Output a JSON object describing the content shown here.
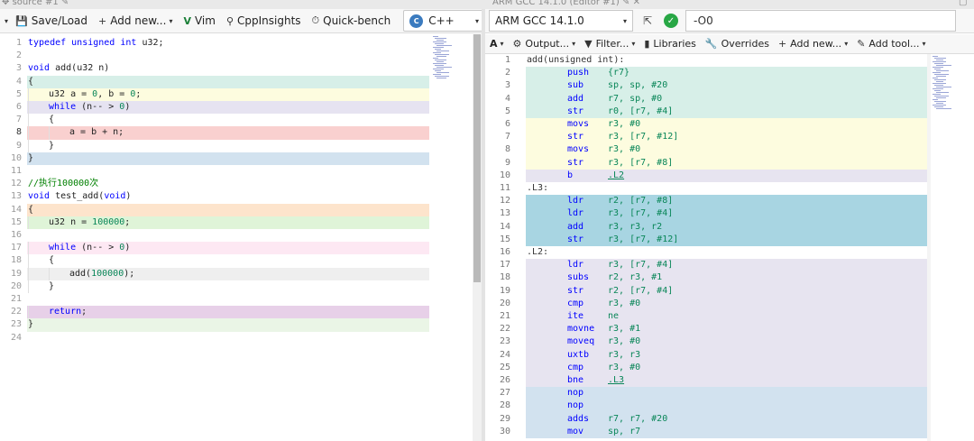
{
  "left_tab": {
    "title": "source #1"
  },
  "right_tab": {
    "title": "ARM GCC 14.1.0 (Editor #1)"
  },
  "toolbar": {
    "save_load": "Save/Load",
    "add_new": "Add new...",
    "vim": "Vim",
    "cppinsights": "CppInsights",
    "quick_bench": "Quick-bench",
    "language": "C++"
  },
  "compiler": {
    "name": "ARM GCC 14.1.0",
    "options": "-O0"
  },
  "output_toolbar": {
    "output": "Output...",
    "filter": "Filter...",
    "libraries": "Libraries",
    "overrides": "Overrides",
    "add_new": "Add new...",
    "add_tool": "Add tool..."
  },
  "colors": {
    "teal": "#d7efe8",
    "yellow": "#fdfcdf",
    "lavender": "#e6e3f1",
    "red": "#f9d0cf",
    "blue": "#d2e2ef",
    "orange": "#fde4cc",
    "green": "#dff4d8",
    "pink": "#fde8f3",
    "gray": "#efefef",
    "purple": "#e7d0e8",
    "light_green": "#eaf5e6",
    "cyan": "#a8d5e2",
    "asm_lav": "#e7e4f0"
  },
  "source_lines": [
    {
      "n": "1",
      "bg": "",
      "indent": 0,
      "tokens": [
        [
          "kw",
          "typedef unsigned int"
        ],
        [
          "",
          "u32;"
        ]
      ]
    },
    {
      "n": "2",
      "bg": "",
      "indent": 0,
      "tokens": []
    },
    {
      "n": "3",
      "bg": "",
      "indent": 0,
      "tokens": [
        [
          "kw",
          "void"
        ],
        [
          "",
          " add(u32 n)"
        ]
      ]
    },
    {
      "n": "4",
      "bg": "teal",
      "indent": 0,
      "tokens": [
        [
          "",
          "{"
        ]
      ]
    },
    {
      "n": "5",
      "bg": "yellow",
      "indent": 1,
      "tokens": [
        [
          "",
          "u32 a = "
        ],
        [
          "num",
          "0"
        ],
        [
          "",
          ", b = "
        ],
        [
          "num",
          "0"
        ],
        [
          "",
          ";"
        ]
      ]
    },
    {
      "n": "6",
      "bg": "lavender",
      "indent": 1,
      "tokens": [
        [
          "kw",
          "while"
        ],
        [
          "",
          " (n-- > "
        ],
        [
          "num",
          "0"
        ],
        [
          "",
          ")"
        ]
      ]
    },
    {
      "n": "7",
      "bg": "",
      "indent": 1,
      "tokens": [
        [
          "",
          "{"
        ]
      ]
    },
    {
      "n": "8",
      "bg": "red",
      "indent": 2,
      "tokens": [
        [
          "",
          "a = b + n;"
        ]
      ]
    },
    {
      "n": "9",
      "bg": "",
      "indent": 1,
      "tokens": [
        [
          "",
          "}"
        ]
      ]
    },
    {
      "n": "10",
      "bg": "blue",
      "indent": 0,
      "tokens": [
        [
          "",
          "}"
        ]
      ]
    },
    {
      "n": "11",
      "bg": "",
      "indent": 0,
      "tokens": []
    },
    {
      "n": "12",
      "bg": "",
      "indent": 0,
      "tokens": [
        [
          "cm",
          "//执行100000次"
        ]
      ]
    },
    {
      "n": "13",
      "bg": "",
      "indent": 0,
      "tokens": [
        [
          "kw",
          "void"
        ],
        [
          "",
          " test_add("
        ],
        [
          "kw",
          "void"
        ],
        [
          "",
          ")"
        ]
      ]
    },
    {
      "n": "14",
      "bg": "orange",
      "indent": 0,
      "tokens": [
        [
          "",
          "{"
        ]
      ]
    },
    {
      "n": "15",
      "bg": "green",
      "indent": 1,
      "tokens": [
        [
          "",
          "u32 n = "
        ],
        [
          "num",
          "100000"
        ],
        [
          "",
          ";"
        ]
      ]
    },
    {
      "n": "16",
      "bg": "",
      "indent": 0,
      "tokens": []
    },
    {
      "n": "17",
      "bg": "pink",
      "indent": 1,
      "tokens": [
        [
          "kw",
          "while"
        ],
        [
          "",
          " (n-- > "
        ],
        [
          "num",
          "0"
        ],
        [
          "",
          ")"
        ]
      ]
    },
    {
      "n": "18",
      "bg": "",
      "indent": 1,
      "tokens": [
        [
          "",
          "{"
        ]
      ]
    },
    {
      "n": "19",
      "bg": "gray",
      "indent": 2,
      "tokens": [
        [
          "",
          "add("
        ],
        [
          "num",
          "100000"
        ],
        [
          "",
          ");"
        ]
      ]
    },
    {
      "n": "20",
      "bg": "",
      "indent": 1,
      "tokens": [
        [
          "",
          "}"
        ]
      ]
    },
    {
      "n": "21",
      "bg": "",
      "indent": 0,
      "tokens": []
    },
    {
      "n": "22",
      "bg": "purple",
      "indent": 1,
      "tokens": [
        [
          "kw",
          "return"
        ],
        [
          "",
          ";"
        ]
      ]
    },
    {
      "n": "23",
      "bg": "light_green",
      "indent": 0,
      "tokens": [
        [
          "",
          "}"
        ]
      ]
    },
    {
      "n": "24",
      "bg": "",
      "indent": 0,
      "tokens": []
    }
  ],
  "asm_lines": [
    {
      "n": "1",
      "bg": "",
      "label": "add(unsigned int):",
      "mn": "",
      "ops": ""
    },
    {
      "n": "2",
      "bg": "teal",
      "label": "",
      "mn": "push",
      "ops": "{r7}"
    },
    {
      "n": "3",
      "bg": "teal",
      "label": "",
      "mn": "sub",
      "ops": "sp, sp, #20"
    },
    {
      "n": "4",
      "bg": "teal",
      "label": "",
      "mn": "add",
      "ops": "r7, sp, #0"
    },
    {
      "n": "5",
      "bg": "teal",
      "label": "",
      "mn": "str",
      "ops": "r0, [r7, #4]"
    },
    {
      "n": "6",
      "bg": "yellow",
      "label": "",
      "mn": "movs",
      "ops": "r3, #0"
    },
    {
      "n": "7",
      "bg": "yellow",
      "label": "",
      "mn": "str",
      "ops": "r3, [r7, #12]"
    },
    {
      "n": "8",
      "bg": "yellow",
      "label": "",
      "mn": "movs",
      "ops": "r3, #0"
    },
    {
      "n": "9",
      "bg": "yellow",
      "label": "",
      "mn": "str",
      "ops": "r3, [r7, #8]"
    },
    {
      "n": "10",
      "bg": "asm_lav",
      "label": "",
      "mn": "b",
      "ops": ".L2",
      "ref": true
    },
    {
      "n": "11",
      "bg": "",
      "label": ".L3:",
      "mn": "",
      "ops": ""
    },
    {
      "n": "12",
      "bg": "cyan",
      "label": "",
      "mn": "ldr",
      "ops": "r2, [r7, #8]"
    },
    {
      "n": "13",
      "bg": "cyan",
      "label": "",
      "mn": "ldr",
      "ops": "r3, [r7, #4]"
    },
    {
      "n": "14",
      "bg": "cyan",
      "label": "",
      "mn": "add",
      "ops": "r3, r3, r2"
    },
    {
      "n": "15",
      "bg": "cyan",
      "label": "",
      "mn": "str",
      "ops": "r3, [r7, #12]"
    },
    {
      "n": "16",
      "bg": "",
      "label": ".L2:",
      "mn": "",
      "ops": ""
    },
    {
      "n": "17",
      "bg": "asm_lav",
      "label": "",
      "mn": "ldr",
      "ops": "r3, [r7, #4]"
    },
    {
      "n": "18",
      "bg": "asm_lav",
      "label": "",
      "mn": "subs",
      "ops": "r2, r3, #1"
    },
    {
      "n": "19",
      "bg": "asm_lav",
      "label": "",
      "mn": "str",
      "ops": "r2, [r7, #4]"
    },
    {
      "n": "20",
      "bg": "asm_lav",
      "label": "",
      "mn": "cmp",
      "ops": "r3, #0"
    },
    {
      "n": "21",
      "bg": "asm_lav",
      "label": "",
      "mn": "ite",
      "ops": "ne"
    },
    {
      "n": "22",
      "bg": "asm_lav",
      "label": "",
      "mn": "movne",
      "ops": "r3, #1"
    },
    {
      "n": "23",
      "bg": "asm_lav",
      "label": "",
      "mn": "moveq",
      "ops": "r3, #0"
    },
    {
      "n": "24",
      "bg": "asm_lav",
      "label": "",
      "mn": "uxtb",
      "ops": "r3, r3"
    },
    {
      "n": "25",
      "bg": "asm_lav",
      "label": "",
      "mn": "cmp",
      "ops": "r3, #0"
    },
    {
      "n": "26",
      "bg": "asm_lav",
      "label": "",
      "mn": "bne",
      "ops": ".L3",
      "ref": true
    },
    {
      "n": "27",
      "bg": "blue",
      "label": "",
      "mn": "nop",
      "ops": ""
    },
    {
      "n": "28",
      "bg": "blue",
      "label": "",
      "mn": "nop",
      "ops": ""
    },
    {
      "n": "29",
      "bg": "blue",
      "label": "",
      "mn": "adds",
      "ops": "r7, r7, #20"
    },
    {
      "n": "30",
      "bg": "blue",
      "label": "",
      "mn": "mov",
      "ops": "sp, r7"
    }
  ]
}
